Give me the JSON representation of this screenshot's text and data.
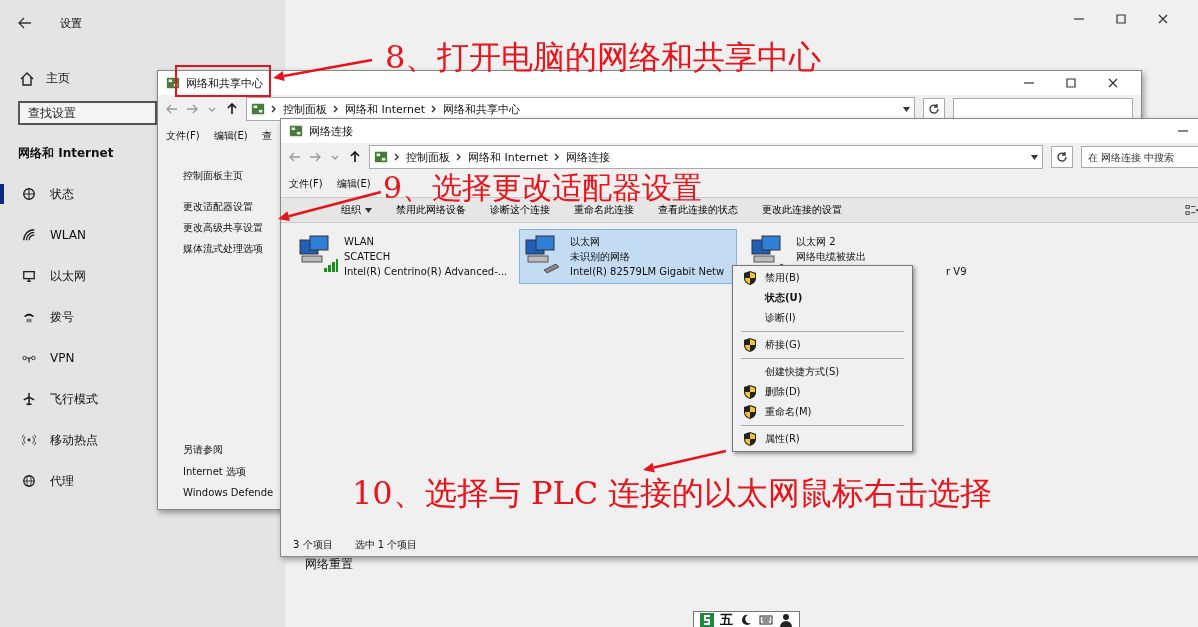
{
  "settings": {
    "title": "设置",
    "home": "主页",
    "search": {
      "placeholder": "查找设置"
    },
    "section": "网络和 Internet",
    "footer_link": "网络重置",
    "nav": [
      {
        "label": "状态",
        "selected": true
      },
      {
        "label": "WLAN",
        "selected": false
      },
      {
        "label": "以太网",
        "selected": false
      },
      {
        "label": "拨号",
        "selected": false
      },
      {
        "label": "VPN",
        "selected": false
      },
      {
        "label": "飞行模式",
        "selected": false
      },
      {
        "label": "移动热点",
        "selected": false
      },
      {
        "label": "代理",
        "selected": false
      }
    ]
  },
  "sharing_center": {
    "title": "网络和共享中心",
    "breadcrumb": [
      "控制面板",
      "网络和 Internet",
      "网络和共享中心"
    ],
    "menu": [
      "文件(F)",
      "编辑(E)",
      "查"
    ],
    "links": [
      "控制面板主页",
      "更改适配器设置",
      "更改高级共享设置",
      "媒体流式处理选项"
    ],
    "see_also": {
      "heading": "另请参阅",
      "links": [
        "Internet 选项",
        "Windows Defende"
      ]
    }
  },
  "connections": {
    "title": "网络连接",
    "breadcrumb": [
      "控制面板",
      "网络和 Internet",
      "网络连接"
    ],
    "search": {
      "placeholder": "在 网络连接 中搜索"
    },
    "menu": [
      "文件(F)",
      "编辑(E)"
    ],
    "toolbar": [
      "组织",
      "禁用此网络设备",
      "诊断这个连接",
      "重命名此连接",
      "查看此连接的状态",
      "更改此连接的设置"
    ],
    "adapters": [
      {
        "name": "WLAN",
        "status": "SCATECH",
        "device": "Intel(R) Centrino(R) Advanced-...",
        "kind": "wireless",
        "selected": false
      },
      {
        "name": "以太网",
        "status": "未识别的网络",
        "device": "Intel(R) 82579LM Gigabit Netw",
        "kind": "wired",
        "selected": true
      },
      {
        "name": "以太网 2",
        "status": "网络电缆被拔出",
        "device": "r V9",
        "kind": "wired",
        "selected": false
      }
    ],
    "status_bar": [
      "3 个项目",
      "选中 1 个项目"
    ]
  },
  "context_menu": {
    "groups": [
      [
        {
          "label": "禁用(B)",
          "shield": true,
          "default": false
        },
        {
          "label": "状态(U)",
          "shield": false,
          "default": true
        },
        {
          "label": "诊断(I)",
          "shield": false,
          "default": false
        }
      ],
      [
        {
          "label": "桥接(G)",
          "shield": true,
          "default": false
        }
      ],
      [
        {
          "label": "创建快捷方式(S)",
          "shield": false,
          "default": false
        },
        {
          "label": "删除(D)",
          "shield": true,
          "default": false
        },
        {
          "label": "重命名(M)",
          "shield": true,
          "default": false
        }
      ],
      [
        {
          "label": "属性(R)",
          "shield": true,
          "default": false
        }
      ]
    ]
  },
  "annotations": [
    {
      "text": "8、打开电脑的网络和共享中心"
    },
    {
      "text": "9、选择更改适配器设置"
    },
    {
      "text": "10、选择与 PLC 连接的以太网鼠标右击选择"
    }
  ],
  "ime_toolbar": {
    "label": "五"
  }
}
